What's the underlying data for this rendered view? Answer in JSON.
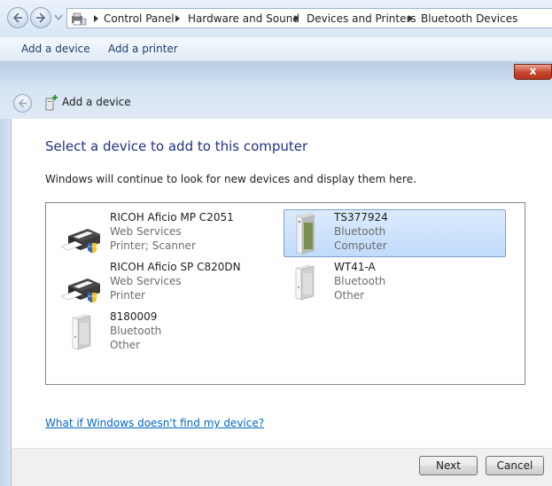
{
  "explorer": {
    "breadcrumb": [
      "Control Panel",
      "Hardware and Sound",
      "Devices and Printers",
      "Bluetooth Devices"
    ],
    "commands": [
      "Add a device",
      "Add a printer"
    ]
  },
  "dialog": {
    "close_label": "x",
    "title": "Add a device",
    "heading": "Select a device to add to this computer",
    "subtext": "Windows will continue to look for new devices and display them here.",
    "devices": [
      {
        "name": "RICOH Aficio MP C2051",
        "line2": "Web Services",
        "line3": "Printer; Scanner",
        "icon": "printer-icon",
        "selected": false
      },
      {
        "name": "TS377924",
        "line2": "Bluetooth",
        "line3": "Computer",
        "icon": "computer-tower-icon",
        "selected": true
      },
      {
        "name": "RICOH Aficio SP C820DN",
        "line2": "Web Services",
        "line3": "Printer",
        "icon": "printer-icon",
        "selected": false
      },
      {
        "name": "WT41-A",
        "line2": "Bluetooth",
        "line3": "Other",
        "icon": "generic-device-icon",
        "selected": false
      },
      {
        "name": "8180009",
        "line2": "Bluetooth",
        "line3": "Other",
        "icon": "generic-device-icon",
        "selected": false
      }
    ],
    "help_link": "What if Windows doesn't find my device?",
    "buttons": {
      "next": "Next",
      "cancel": "Cancel"
    }
  }
}
